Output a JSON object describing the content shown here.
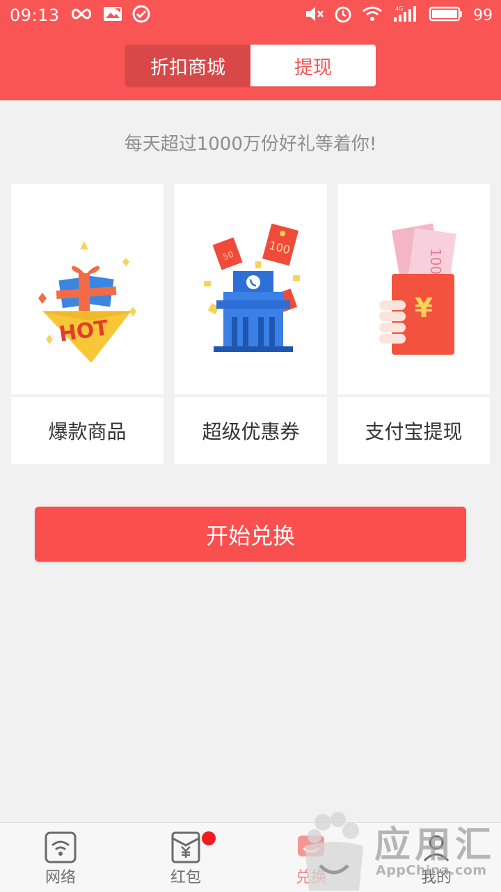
{
  "status_bar": {
    "time": "09:13",
    "battery": "99",
    "network": "4G"
  },
  "tabs": [
    {
      "label": "折扣商城",
      "active": true
    },
    {
      "label": "提现",
      "active": false
    }
  ],
  "tagline": "每天超过1000万份好礼等着你!",
  "cards": [
    {
      "label": "爆款商品",
      "image_text": "HOT"
    },
    {
      "label": "超级优惠券",
      "image_text_1": "50",
      "image_text_2": "100"
    },
    {
      "label": "支付宝提现",
      "image_text_1": "100",
      "image_text_2": "¥"
    }
  ],
  "cta_label": "开始兑换",
  "bottom_nav": [
    {
      "label": "网络",
      "icon": "wifi-icon"
    },
    {
      "label": "红包",
      "icon": "red-envelope-icon",
      "badge": true
    },
    {
      "label": "兑换",
      "icon": "exchange-icon",
      "active": true
    },
    {
      "label": "我的",
      "icon": "profile-icon"
    }
  ],
  "watermark": {
    "cn": "应用汇",
    "en": "AppChina.com"
  },
  "colors": {
    "brand_red": "#fa5555",
    "tab_active": "#d94848",
    "button_red": "#f94f4f",
    "background": "#f1f1f1",
    "badge": "#ee1c1c"
  }
}
